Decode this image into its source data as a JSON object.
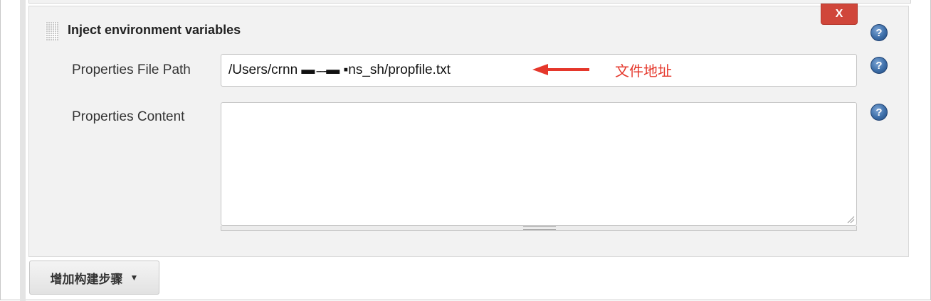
{
  "step": {
    "title": "Inject environment variables",
    "delete_label": "X"
  },
  "fields": {
    "file_path_label": "Properties File Path",
    "file_path_value": "/Users/crnn ▬  ̵ ̵ ̵̵▬ ▪ns_sh/propfile.txt",
    "content_label": "Properties Content",
    "content_value": ""
  },
  "help": {
    "glyph": "?"
  },
  "annotation": {
    "text": "文件地址",
    "color": "#e5372b"
  },
  "footer": {
    "add_step_label": "增加构建步骤",
    "caret": "▼"
  },
  "colors": {
    "delete_button": "#d0463a",
    "help_icon": "#3d6ea8",
    "panel_background": "#f2f2f2"
  }
}
